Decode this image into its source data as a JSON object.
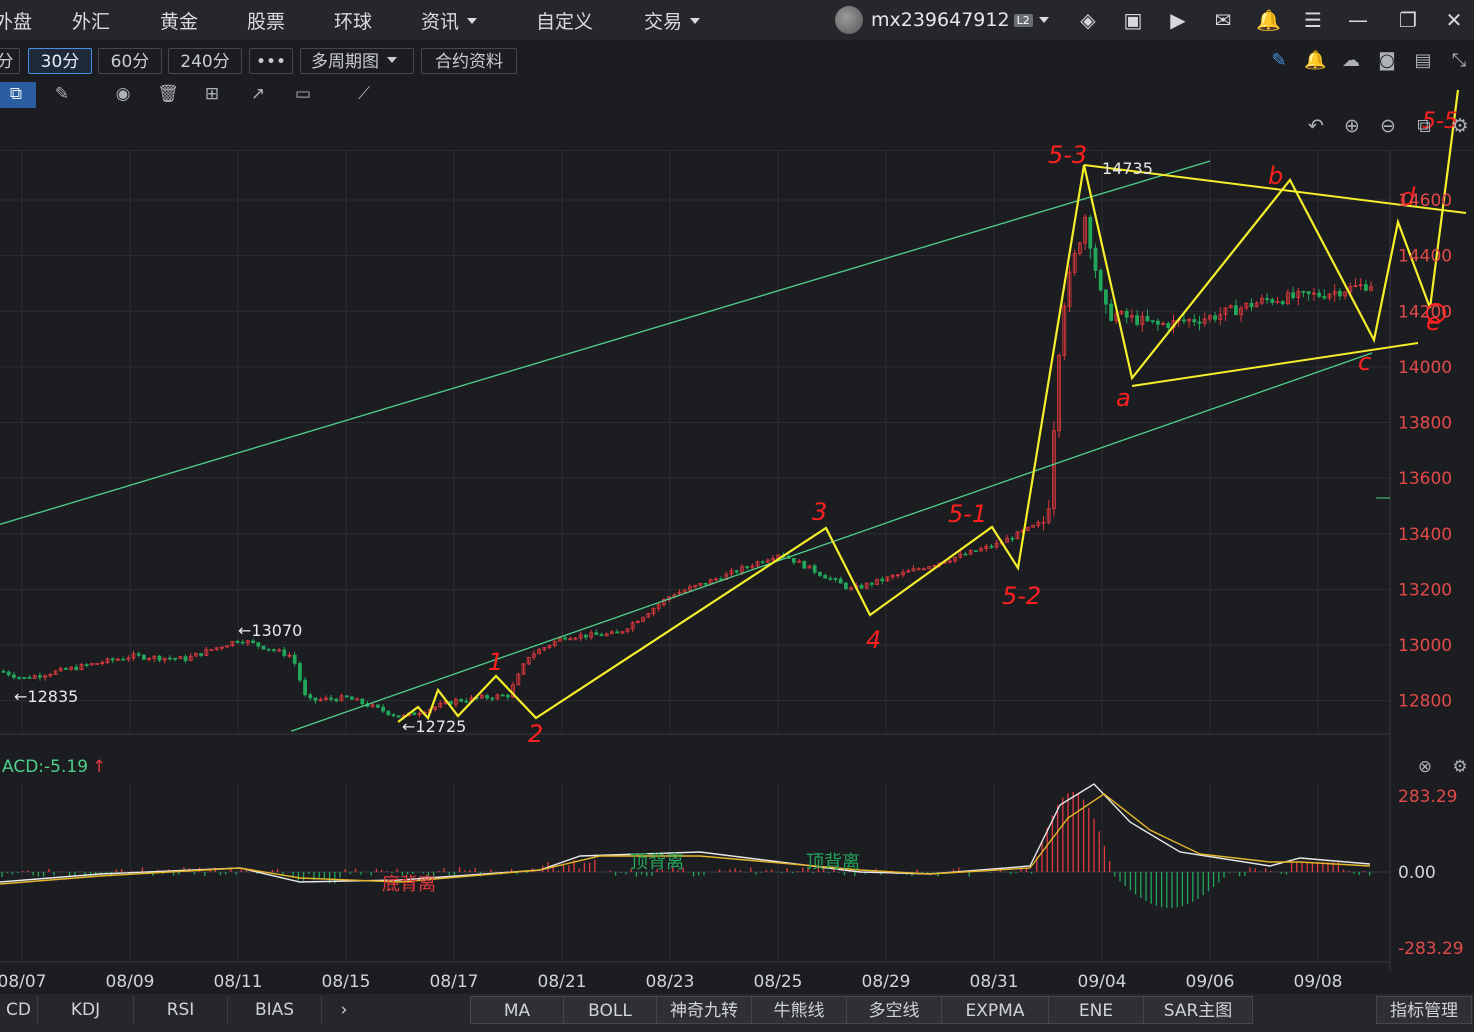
{
  "nav": {
    "items": [
      "外盘",
      "外汇",
      "黄金",
      "股票",
      "环球",
      "资讯",
      "自定义",
      "交易"
    ],
    "username": "mx239647912",
    "level_badge": "L2"
  },
  "toolbar": {
    "periods": [
      "分",
      "30分",
      "60分",
      "240分",
      "•••",
      "多周期图",
      "合约资料"
    ],
    "active_period": "30分"
  },
  "indicator_tabs_left": [
    "CD",
    "KDJ",
    "RSI",
    "BIAS"
  ],
  "indicator_tabs_right": [
    "MA",
    "BOLL",
    "神奇九转",
    "牛熊线",
    "多空线",
    "EXPMA",
    "ENE",
    "SAR主图"
  ],
  "indicator_manage": "指标管理",
  "chart_data": [
    {
      "type": "candlestick",
      "x_labels": [
        "08/07",
        "08/09",
        "08/11",
        "08/15",
        "08/17",
        "08/21",
        "08/23",
        "08/25",
        "08/29",
        "08/31",
        "09/04",
        "09/06",
        "09/08"
      ],
      "ylim": [
        12680,
        14780
      ],
      "y_ticks": [
        12800,
        13000,
        13200,
        13400,
        13600,
        13800,
        14000,
        14200,
        14400,
        14600
      ],
      "y_tick_labels": [
        "12800",
        "13000",
        "13200",
        "13400",
        "13600",
        "13800",
        "14000",
        "14200",
        "14400",
        "14600"
      ],
      "colors": {
        "up": "#e0393e",
        "down": "#22a65a",
        "channel": "#4fd08a",
        "annotation": "#f5ef2b",
        "marks": "#ff2020"
      },
      "price_marks": [
        {
          "label": "←12835",
          "value": 12835,
          "x_date": "08/07"
        },
        {
          "label": "←13070",
          "value": 13070,
          "x_date": "08/11"
        },
        {
          "label": "←12725",
          "value": 12725,
          "x_date": "08/16"
        },
        {
          "label": "14735",
          "value": 14735,
          "x_date": "09/03"
        }
      ],
      "close_path": [
        {
          "x": "08/06",
          "y": 12940
        },
        {
          "x": "08/07",
          "y": 12880
        },
        {
          "x": "08/08",
          "y": 12920
        },
        {
          "x": "08/09",
          "y": 12960
        },
        {
          "x": "08/10",
          "y": 12950
        },
        {
          "x": "08/11",
          "y": 13020
        },
        {
          "x": "08/12",
          "y": 12960
        },
        {
          "x": "08/14",
          "y": 12800
        },
        {
          "x": "08/15",
          "y": 12810
        },
        {
          "x": "08/16",
          "y": 12740
        },
        {
          "x": "08/17",
          "y": 12800
        },
        {
          "x": "08/18",
          "y": 12820
        },
        {
          "x": "08/20",
          "y": 12960
        },
        {
          "x": "08/21",
          "y": 13030
        },
        {
          "x": "08/22",
          "y": 13040
        },
        {
          "x": "08/23",
          "y": 13180
        },
        {
          "x": "08/24",
          "y": 13250
        },
        {
          "x": "08/25",
          "y": 13330
        },
        {
          "x": "08/28",
          "y": 13200
        },
        {
          "x": "08/29",
          "y": 13240
        },
        {
          "x": "08/30",
          "y": 13300
        },
        {
          "x": "08/31",
          "y": 13360
        },
        {
          "x": "09/01",
          "y": 13450
        },
        {
          "x": "09/02",
          "y": 14200
        },
        {
          "x": "09/03",
          "y": 14550
        },
        {
          "x": "09/04",
          "y": 14200
        },
        {
          "x": "09/05",
          "y": 14150
        },
        {
          "x": "09/06",
          "y": 14180
        },
        {
          "x": "09/07",
          "y": 14240
        },
        {
          "x": "09/08",
          "y": 14260
        },
        {
          "x": "09/09",
          "y": 14300
        }
      ],
      "channel_lines": [
        {
          "from": {
            "x": "08/01",
            "y": 13380
          },
          "to": {
            "x": "09/06",
            "y": 14740
          }
        },
        {
          "from": {
            "x": "08/12",
            "y": 12690
          },
          "to": {
            "x": "09/09",
            "y": 14050
          }
        }
      ],
      "wave_labels": [
        {
          "text": "1",
          "x": "08/18",
          "y": 12930
        },
        {
          "text": "2",
          "x": "08/20",
          "y": 12700
        },
        {
          "text": "3",
          "x": "08/26",
          "y": 13450
        },
        {
          "text": "4",
          "x": "08/28",
          "y": 13020
        },
        {
          "text": "5-1",
          "x": "08/31",
          "y": 13450
        },
        {
          "text": "5-2",
          "x": "09/01",
          "y": 13190
        },
        {
          "text": "5-3",
          "x": "09/02",
          "y": 14780
        },
        {
          "text": "a",
          "x": "09/04",
          "y": 13920
        },
        {
          "text": "b",
          "x": "09/07",
          "y": 14700
        },
        {
          "text": "c",
          "x": "09/08",
          "y": 14030
        },
        {
          "text": "d",
          "x": "09/09",
          "y": 14620
        },
        {
          "text": "e",
          "x": "09/10",
          "y": 14170
        },
        {
          "text": "5-5",
          "x": "09/10",
          "y": 14500
        }
      ]
    },
    {
      "type": "line",
      "title": "ACD:-5.19",
      "ylim": [
        -283.29,
        283.29
      ],
      "y_tick_labels": [
        "283.29",
        "0.00",
        "-283.29"
      ],
      "annotations": [
        "底背离",
        "顶背离",
        "顶背离"
      ],
      "colors": {
        "dif": "#e8e8e8",
        "dea": "#e5b52a",
        "up": "#e0393e",
        "down": "#22a65a"
      }
    }
  ]
}
